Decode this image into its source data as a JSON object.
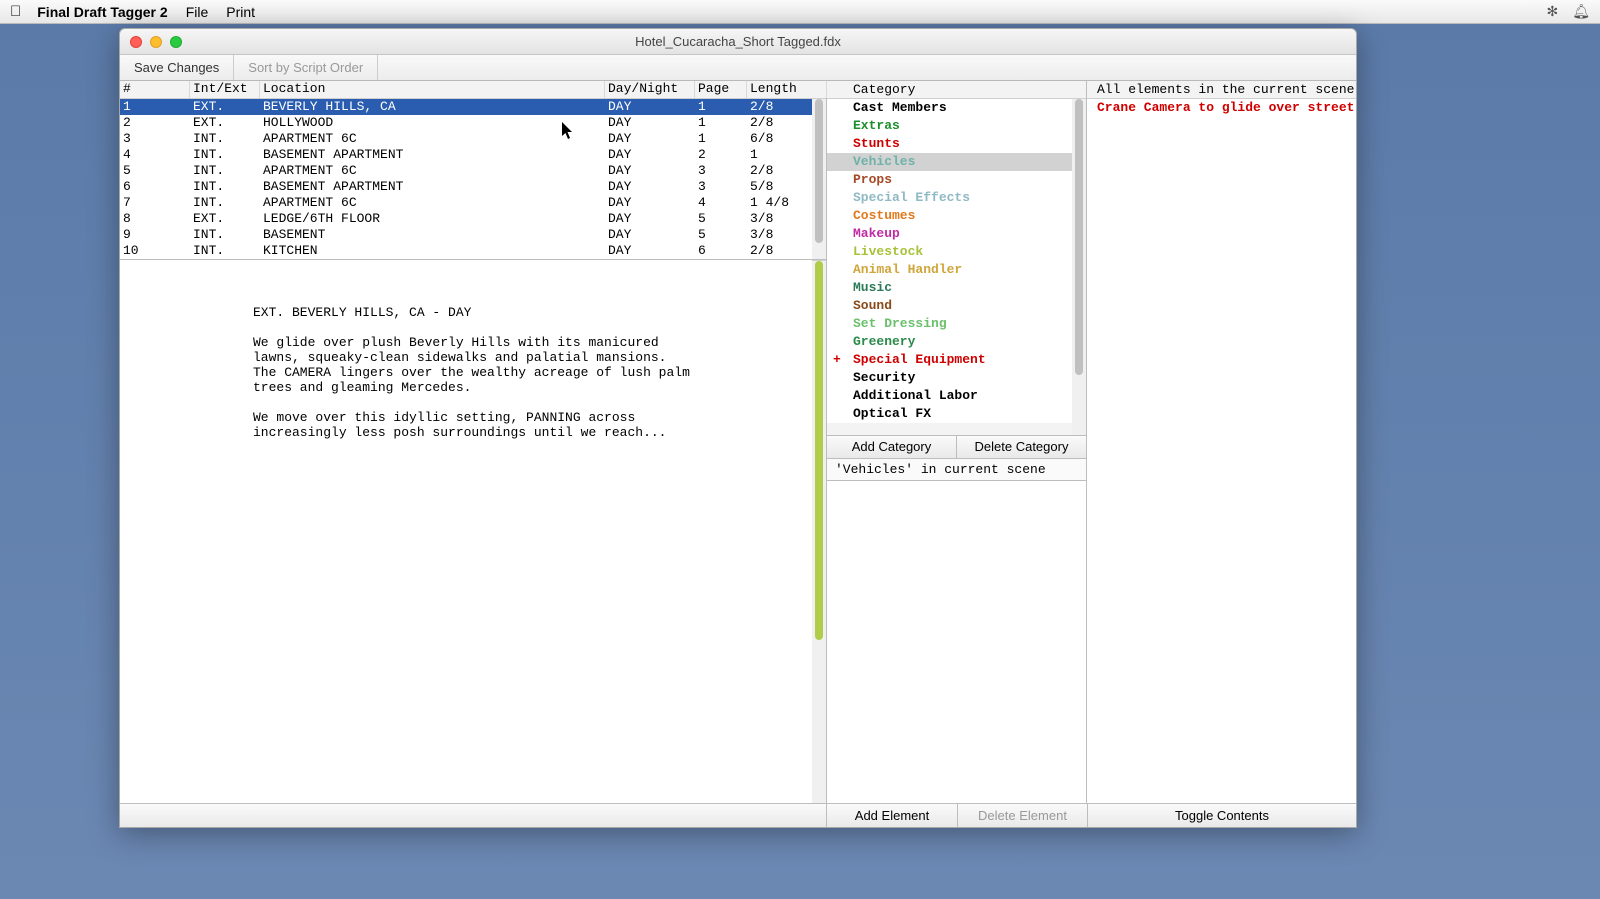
{
  "menubar": {
    "app_name": "Final Draft Tagger 2",
    "items": [
      "File",
      "Print"
    ]
  },
  "window": {
    "title": "Hotel_Cucaracha_Short Tagged.fdx"
  },
  "toolbar": {
    "save_label": "Save Changes",
    "sort_label": "Sort by Script Order"
  },
  "scene_table": {
    "headers": {
      "num": "#",
      "intExt": "Int/Ext",
      "location": "Location",
      "dayNight": "Day/Night",
      "page": "Page",
      "length": "Length"
    },
    "rows": [
      {
        "num": "1",
        "intExt": "EXT.",
        "location": "BEVERLY HILLS, CA",
        "dayNight": "DAY",
        "page": "1",
        "length": "2/8",
        "selected": true
      },
      {
        "num": "2",
        "intExt": "EXT.",
        "location": "HOLLYWOOD",
        "dayNight": "DAY",
        "page": "1",
        "length": "2/8"
      },
      {
        "num": "3",
        "intExt": "INT.",
        "location": "APARTMENT 6C",
        "dayNight": "DAY",
        "page": "1",
        "length": "6/8"
      },
      {
        "num": "4",
        "intExt": "INT.",
        "location": "BASEMENT APARTMENT",
        "dayNight": "DAY",
        "page": "2",
        "length": "1"
      },
      {
        "num": "5",
        "intExt": "INT.",
        "location": "APARTMENT 6C",
        "dayNight": "DAY",
        "page": "3",
        "length": "2/8"
      },
      {
        "num": "6",
        "intExt": "INT.",
        "location": "BASEMENT APARTMENT",
        "dayNight": "DAY",
        "page": "3",
        "length": "5/8"
      },
      {
        "num": "7",
        "intExt": "INT.",
        "location": "APARTMENT 6C",
        "dayNight": "DAY",
        "page": "4",
        "length": "1 4/8"
      },
      {
        "num": "8",
        "intExt": "EXT.",
        "location": "LEDGE/6TH FLOOR",
        "dayNight": "DAY",
        "page": "5",
        "length": "3/8"
      },
      {
        "num": "9",
        "intExt": "INT.",
        "location": "BASEMENT",
        "dayNight": "DAY",
        "page": "5",
        "length": "3/8"
      },
      {
        "num": "10",
        "intExt": "INT.",
        "location": "KITCHEN",
        "dayNight": "DAY",
        "page": "6",
        "length": "2/8"
      }
    ]
  },
  "script": {
    "slugline": "EXT. BEVERLY HILLS, CA - DAY",
    "p1": "We glide over plush Beverly Hills with its manicured\nlawns, squeaky-clean sidewalks and palatial mansions.\nThe CAMERA lingers over the wealthy acreage of lush palm\ntrees and gleaming Mercedes.",
    "p2": "We move over this idyllic setting, PANNING across\nincreasingly less posh surroundings until we reach..."
  },
  "categories": {
    "header": "Category",
    "items": [
      {
        "name": "Cast Members",
        "color": "#000000"
      },
      {
        "name": "Extras",
        "color": "#1c8f2c"
      },
      {
        "name": "Stunts",
        "color": "#cf0000"
      },
      {
        "name": "Vehicles",
        "color": "#6fb2aa",
        "selected": true
      },
      {
        "name": "Props",
        "color": "#a54a26"
      },
      {
        "name": "Special Effects",
        "color": "#8fb9c4"
      },
      {
        "name": "Costumes",
        "color": "#e07a1e"
      },
      {
        "name": "Makeup",
        "color": "#c22aa4"
      },
      {
        "name": "Livestock",
        "color": "#a6c23a"
      },
      {
        "name": "Animal Handler",
        "color": "#d0a53a"
      },
      {
        "name": "Music",
        "color": "#2a7a5a"
      },
      {
        "name": "Sound",
        "color": "#8a4a1a"
      },
      {
        "name": "Set Dressing",
        "color": "#6bc06b"
      },
      {
        "name": "Greenery",
        "color": "#2a8a4a"
      },
      {
        "name": "Special Equipment",
        "color": "#cf0000",
        "marked": true
      },
      {
        "name": "Security",
        "color": "#000000"
      },
      {
        "name": "Additional Labor",
        "color": "#000000"
      },
      {
        "name": "Optical FX",
        "color": "#000000"
      }
    ],
    "add_label": "Add Category",
    "delete_label": "Delete Category",
    "scene_label": "'Vehicles' in current scene"
  },
  "elements": {
    "header": "All elements in the current scene",
    "items": [
      {
        "text": "Crane Camera to glide over street",
        "color": "#cf0000"
      }
    ],
    "add_label": "Add Element",
    "delete_label": "Delete Element",
    "toggle_label": "Toggle Contents"
  }
}
